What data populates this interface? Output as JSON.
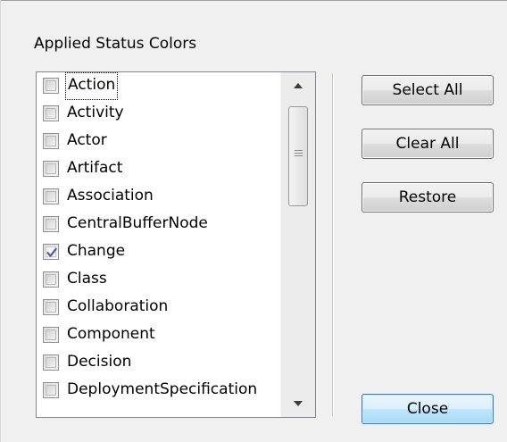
{
  "group": {
    "title": "Applied Status Colors"
  },
  "list": {
    "items": [
      {
        "label": "Action",
        "checked": false
      },
      {
        "label": "Activity",
        "checked": false
      },
      {
        "label": "Actor",
        "checked": false
      },
      {
        "label": "Artifact",
        "checked": false
      },
      {
        "label": "Association",
        "checked": false
      },
      {
        "label": "CentralBufferNode",
        "checked": false
      },
      {
        "label": "Change",
        "checked": true
      },
      {
        "label": "Class",
        "checked": false
      },
      {
        "label": "Collaboration",
        "checked": false
      },
      {
        "label": "Component",
        "checked": false
      },
      {
        "label": "Decision",
        "checked": false
      },
      {
        "label": "DeploymentSpecification",
        "checked": false
      }
    ]
  },
  "buttons": {
    "select_all": "Select All",
    "clear_all": "Clear All",
    "restore": "Restore",
    "close": "Close"
  },
  "colors": {
    "default_button_border": "#3c7fb1",
    "check_mark": "#4a5f97"
  },
  "icons": {
    "scroll_up": "arrow-up-icon",
    "scroll_down": "arrow-down-icon",
    "check": "checkmark-icon"
  }
}
